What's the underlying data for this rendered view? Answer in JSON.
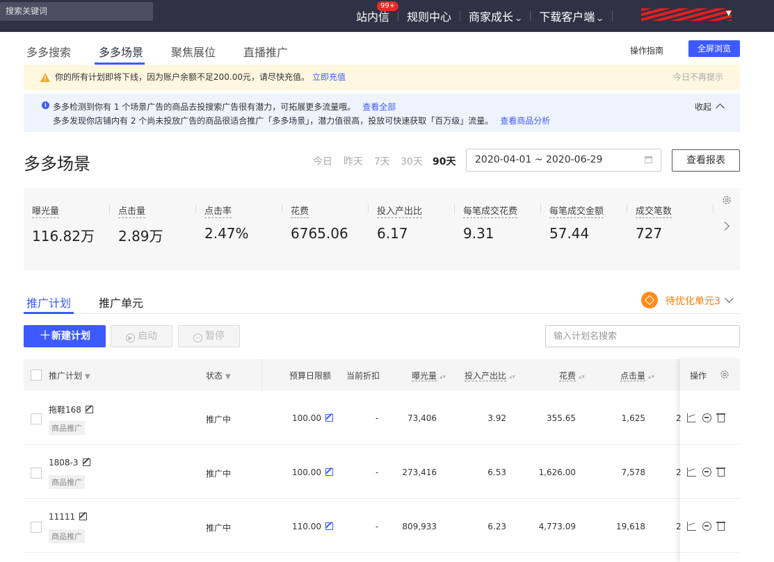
{
  "topbar": {
    "search_placeholder": "搜索关键词",
    "nav": [
      {
        "label": "站内信",
        "badge": "99+"
      },
      {
        "label": "规则中心"
      },
      {
        "label": "商家成长",
        "has_dropdown": true
      },
      {
        "label": "下载客户端",
        "has_dropdown": true
      }
    ]
  },
  "tabs": [
    "多多搜索",
    "多多场景",
    "聚焦展位",
    "直播推广"
  ],
  "active_tab": "多多场景",
  "header_actions": {
    "guide": "操作指南",
    "fullscreen": "全屏浏览"
  },
  "alert_warning": {
    "text": "你的所有计划即将下线，因为账户余额不足200.00元，请尽快充值。",
    "link": "立即充值",
    "dismiss": "今日不再提示"
  },
  "alert_info": {
    "line1": "多多检测到你有 1 个场景广告的商品去投搜索广告很有潜力，可拓展更多流量哦。",
    "line1_link": "查看全部",
    "line2": "多多发现你店铺内有 2 个尚未投放广告的商品很适合推广「多多场景」，潜力值很高，投放可快速获取「百万级」流量。",
    "line2_link": "查看商品分析",
    "collapse": "收起"
  },
  "page_title": "多多场景",
  "date_options": [
    "今日",
    "昨天",
    "7天",
    "30天",
    "90天"
  ],
  "date_active": "90天",
  "date_range": "2020-04-01 ~ 2020-06-29",
  "report_button": "查看报表",
  "metrics": [
    {
      "label": "曝光量",
      "value": "116.82万"
    },
    {
      "label": "点击量",
      "value": "2.89万"
    },
    {
      "label": "点击率",
      "value": "2.47%"
    },
    {
      "label": "花费",
      "value": "6765.06"
    },
    {
      "label": "投入产出比",
      "value": "6.17"
    },
    {
      "label": "每笔成交花费",
      "value": "9.31"
    },
    {
      "label": "每笔成交金额",
      "value": "57.44"
    },
    {
      "label": "成交笔数",
      "value": "727"
    }
  ],
  "plan_tabs": [
    "推广计划",
    "推广单元"
  ],
  "optimize_label": "待优化单元3",
  "toolbar": {
    "new_plan": "新建计划",
    "start": "启动",
    "pause": "暂停",
    "search_placeholder": "输入计划名搜索"
  },
  "table": {
    "headers": {
      "plan": "推广计划",
      "status": "状态",
      "budget": "预算日限额",
      "discount": "当前折扣",
      "impressions": "曝光量",
      "roi": "投入产出比",
      "cost": "花费",
      "clicks": "点击量",
      "ops": "操作"
    },
    "rows": [
      {
        "name": "拖鞋168",
        "tag": "商品推广",
        "status": "推广中",
        "budget": "100.00",
        "discount": "-",
        "impressions": "73,406",
        "roi": "3.92",
        "cost": "355.65",
        "clicks": "1,625",
        "extra": "2"
      },
      {
        "name": "1808-3",
        "tag": "商品推广",
        "status": "推广中",
        "budget": "100.00",
        "discount": "-",
        "impressions": "273,416",
        "roi": "6.53",
        "cost": "1,626.00",
        "clicks": "7,578",
        "extra": "2"
      },
      {
        "name": "11111",
        "tag": "商品推广",
        "status": "推广中",
        "budget": "110.00",
        "discount": "-",
        "impressions": "809,933",
        "roi": "6.23",
        "cost": "4,773.09",
        "clicks": "19,618",
        "extra": "2"
      }
    ]
  },
  "colors": {
    "topbar": "#2f3245",
    "accent": "#3d5afe",
    "warning_bg": "#fff7e0",
    "info_bg": "#eef3fd",
    "badge": "#e02e24",
    "optimize": "#ff7a00"
  }
}
